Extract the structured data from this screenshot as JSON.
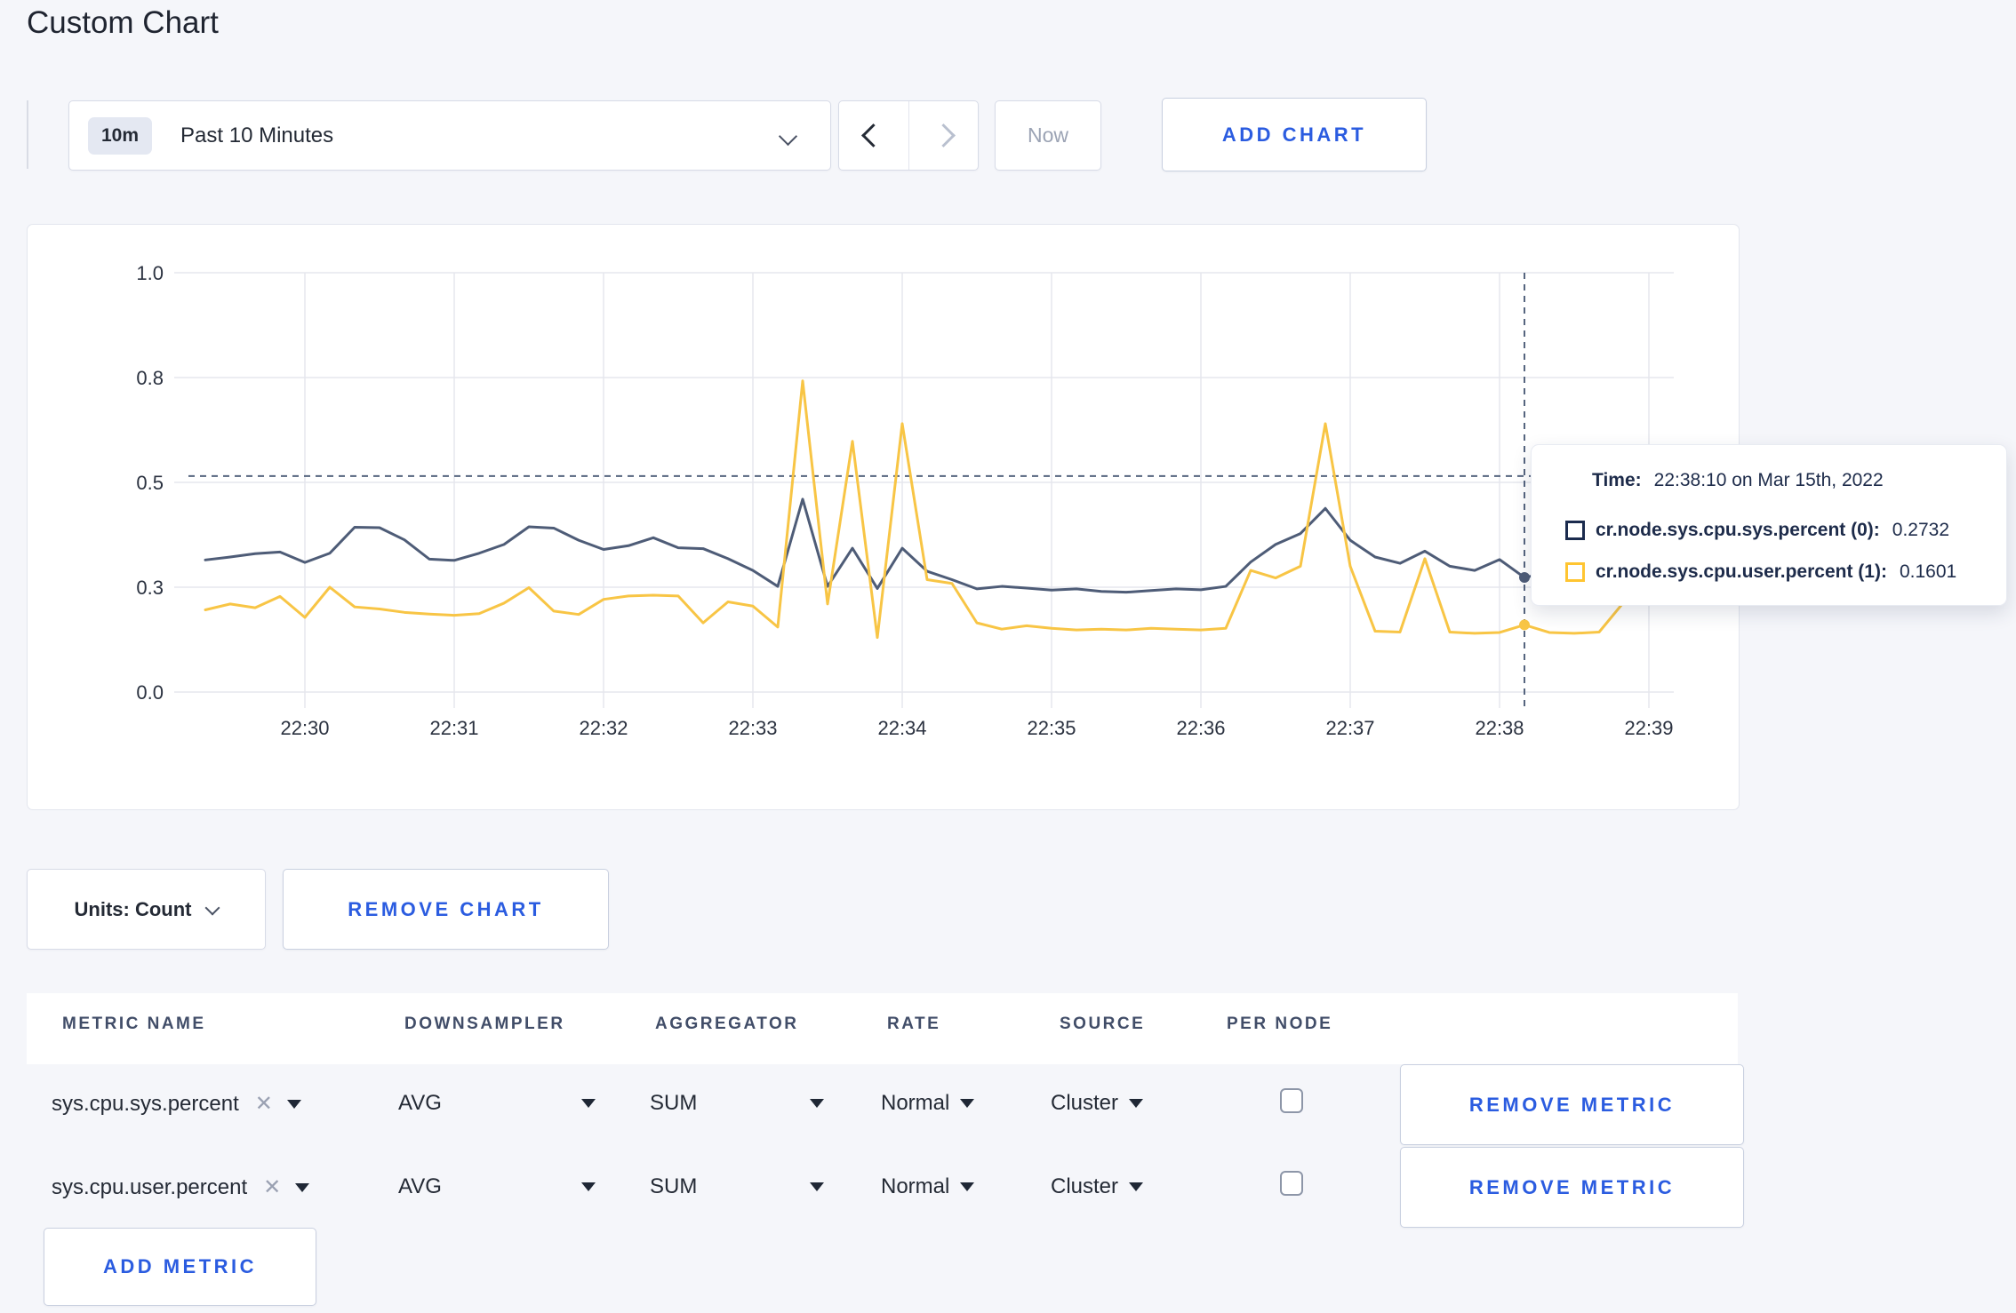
{
  "page": {
    "title": "Custom Chart",
    "background": "#f5f6fa",
    "accent_blue": "#2b5ce0"
  },
  "toolbar": {
    "time_range": {
      "badge": "10m",
      "label": "Past 10 Minutes"
    },
    "now_label": "Now",
    "add_chart_label": "ADD CHART"
  },
  "icons": {
    "clear": "✕"
  },
  "chart_data": {
    "type": "line",
    "title": "",
    "xlabel": "",
    "ylabel": "",
    "x_start": "22:29:20",
    "x_step_seconds": 10,
    "x_tick_labels": [
      "22:30",
      "22:31",
      "22:32",
      "22:33",
      "22:34",
      "22:35",
      "22:36",
      "22:37",
      "22:38",
      "22:39"
    ],
    "y_ticks": [
      {
        "v": 0.0,
        "label": "0.0"
      },
      {
        "v": 0.25,
        "label": "0.3"
      },
      {
        "v": 0.5,
        "label": "0.5"
      },
      {
        "v": 0.75,
        "label": "0.8"
      },
      {
        "v": 1.0,
        "label": "1.0"
      }
    ],
    "ylim": [
      0,
      1
    ],
    "grid": true,
    "legend_position": "none",
    "series": [
      {
        "name": "cr.node.sys.cpu.sys.percent (0)",
        "color": "#4e5c77",
        "values": [
          0.315,
          0.322,
          0.33,
          0.334,
          0.309,
          0.331,
          0.393,
          0.392,
          0.363,
          0.317,
          0.314,
          0.331,
          0.352,
          0.394,
          0.391,
          0.362,
          0.34,
          0.349,
          0.368,
          0.344,
          0.342,
          0.318,
          0.29,
          0.252,
          0.46,
          0.252,
          0.343,
          0.247,
          0.343,
          0.288,
          0.268,
          0.246,
          0.252,
          0.248,
          0.243,
          0.246,
          0.24,
          0.238,
          0.242,
          0.246,
          0.244,
          0.252,
          0.31,
          0.352,
          0.378,
          0.438,
          0.362,
          0.322,
          0.307,
          0.336,
          0.3,
          0.29,
          0.316,
          0.2732,
          0.285,
          0.295,
          0.308,
          0.3,
          0.306,
          0.326
        ]
      },
      {
        "name": "cr.node.sys.cpu.user.percent (1)",
        "color": "#f8c545",
        "values": [
          0.196,
          0.21,
          0.201,
          0.228,
          0.178,
          0.25,
          0.203,
          0.198,
          0.19,
          0.186,
          0.183,
          0.187,
          0.212,
          0.249,
          0.193,
          0.185,
          0.221,
          0.229,
          0.231,
          0.229,
          0.165,
          0.215,
          0.205,
          0.155,
          0.742,
          0.21,
          0.598,
          0.13,
          0.64,
          0.268,
          0.259,
          0.165,
          0.15,
          0.158,
          0.152,
          0.148,
          0.15,
          0.148,
          0.152,
          0.15,
          0.148,
          0.152,
          0.29,
          0.272,
          0.3,
          0.64,
          0.3,
          0.145,
          0.143,
          0.318,
          0.143,
          0.14,
          0.142,
          0.1601,
          0.142,
          0.14,
          0.143,
          0.215,
          0.272,
          0.235
        ]
      }
    ],
    "crosshair": {
      "index": 53,
      "guide_y": 0.515,
      "time": "22:38:10"
    }
  },
  "tooltip": {
    "time_label": "Time:",
    "time_value": "22:38:10 on Mar 15th, 2022",
    "rows": [
      {
        "name": "cr.node.sys.cpu.sys.percent (0):",
        "value": "0.2732",
        "color": "#1b2b4e"
      },
      {
        "name": "cr.node.sys.cpu.user.percent (1):",
        "value": "0.1601",
        "color": "#ffc531"
      }
    ]
  },
  "controls": {
    "units_label": "Units: Count",
    "remove_chart_label": "REMOVE CHART"
  },
  "metrics": {
    "columns": [
      "METRIC NAME",
      "DOWNSAMPLER",
      "AGGREGATOR",
      "RATE",
      "SOURCE",
      "PER NODE"
    ],
    "rows": [
      {
        "name": "sys.cpu.sys.percent",
        "downsampler": "AVG",
        "aggregator": "SUM",
        "rate": "Normal",
        "source": "Cluster",
        "per_node_checked": false,
        "remove_label": "REMOVE METRIC"
      },
      {
        "name": "sys.cpu.user.percent",
        "downsampler": "AVG",
        "aggregator": "SUM",
        "rate": "Normal",
        "source": "Cluster",
        "per_node_checked": false,
        "remove_label": "REMOVE METRIC"
      }
    ],
    "add_metric_label": "ADD METRIC"
  }
}
